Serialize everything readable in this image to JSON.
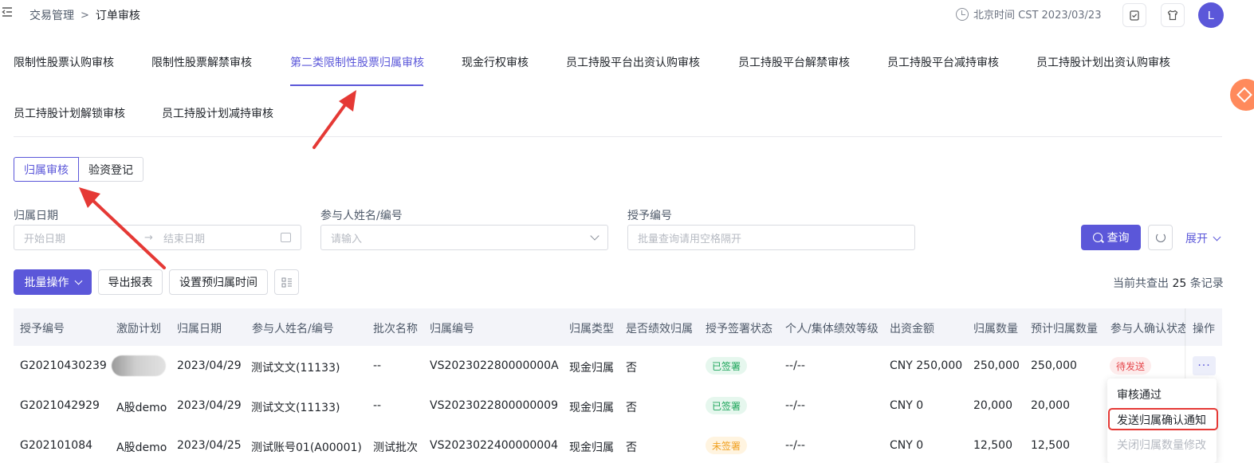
{
  "breadcrumb": {
    "parent": "交易管理",
    "sep": ">",
    "current": "订单审核"
  },
  "clock": {
    "text": "北京时间 CST 2023/03/23"
  },
  "user": {
    "avatar_letter": "L"
  },
  "tabs": [
    {
      "label": "限制性股票认购审核"
    },
    {
      "label": "限制性股票解禁审核"
    },
    {
      "label": "第二类限制性股票归属审核",
      "active": true
    },
    {
      "label": "现金行权审核"
    },
    {
      "label": "员工持股平台出资认购审核"
    },
    {
      "label": "员工持股平台解禁审核"
    },
    {
      "label": "员工持股平台减持审核"
    },
    {
      "label": "员工持股计划出资认购审核"
    },
    {
      "label": "员工持股计划解锁审核"
    },
    {
      "label": "员工持股计划减持审核"
    }
  ],
  "segment": {
    "active": "归属审核",
    "other": "验资登记"
  },
  "filters": {
    "date_label": "归属日期",
    "start_placeholder": "开始日期",
    "range_arrow": "→",
    "end_placeholder": "结束日期",
    "participant_label": "参与人姓名/编号",
    "participant_placeholder": "请输入",
    "grant_label": "授予编号",
    "grant_placeholder": "批量查询请用空格隔开",
    "search_button": "查询",
    "expand_button": "展开"
  },
  "toolbar": {
    "batch_button": "批量操作",
    "export_button": "导出报表",
    "preset_button": "设置预归属时间",
    "count_prefix": "当前共查出",
    "count_value": "25",
    "count_suffix": "条记录"
  },
  "table": {
    "columns": [
      "授予编号",
      "激励计划",
      "归属日期",
      "参与人姓名/编号",
      "批次名称",
      "归属编号",
      "归属类型",
      "是否绩效归属",
      "授予签署状态",
      "个人/集体绩效等级",
      "出资金额",
      "归属数量",
      "预计归属数量",
      "参与人确认状态",
      "操作"
    ],
    "rows": [
      {
        "grant_no": "G20210430239",
        "plan": "",
        "date": "2023/04/29",
        "participant": "测试文文(11133)",
        "batch": "--",
        "vest_no": "VS202302280000000A",
        "type": "现金归属",
        "perf": "否",
        "sign": "已签署",
        "sign_status": "ok",
        "grade": "--/--",
        "amount": "CNY 250,000",
        "qty": "250,000",
        "est_qty": "250,000",
        "confirm": "待发送",
        "more": "···"
      },
      {
        "grant_no": "G2021042929",
        "plan": "A股demo",
        "date": "2023/04/29",
        "participant": "测试文文(11133)",
        "batch": "--",
        "vest_no": "VS2023022800000009",
        "type": "现金归属",
        "perf": "否",
        "sign": "已签署",
        "sign_status": "ok",
        "grade": "--/--",
        "amount": "CNY 0",
        "qty": "20,000",
        "est_qty": "20,000"
      },
      {
        "grant_no": "G202101084",
        "plan": "A股demo",
        "date": "2023/04/25",
        "participant": "测试账号01(A00001)",
        "batch": "测试批次",
        "vest_no": "VS2023022400000004",
        "type": "现金归属",
        "perf": "否",
        "sign": "未签署",
        "sign_status": "warn",
        "grade": "--/--",
        "amount": "CNY 0",
        "qty": "12,500",
        "est_qty": "12,500"
      }
    ]
  },
  "dropdown": {
    "items": [
      "审核通过",
      "发送归属确认通知",
      "关闭归属数量修改"
    ]
  },
  "colors": {
    "primary": "#5b57d9",
    "annotation": "#e53935"
  }
}
